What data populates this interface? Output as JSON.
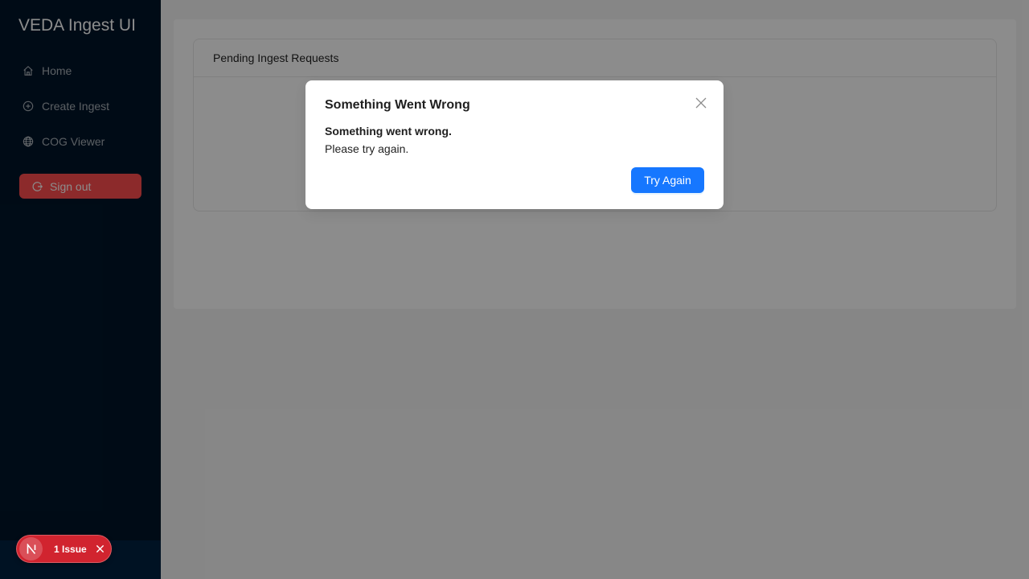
{
  "sidebar": {
    "app_title": "VEDA Ingest UI",
    "items": [
      {
        "label": "Home",
        "icon": "home-icon"
      },
      {
        "label": "Create Ingest",
        "icon": "plus-circle-icon"
      },
      {
        "label": "COG Viewer",
        "icon": "globe-icon"
      }
    ],
    "signout_label": "Sign out",
    "signout_icon": "logout-icon"
  },
  "main": {
    "card_title": "Pending Ingest Requests"
  },
  "modal": {
    "title": "Something Went Wrong",
    "message_strong": "Something went wrong.",
    "message": "Please try again.",
    "primary_button": "Try Again"
  },
  "dev_overlay": {
    "logo_letter": "N",
    "issue_label": "1 Issue"
  },
  "colors": {
    "sidebar_bg": "#001529",
    "signout_bg": "#ff4d4f",
    "primary": "#1677ff",
    "issue_badge": "#d1242f"
  }
}
